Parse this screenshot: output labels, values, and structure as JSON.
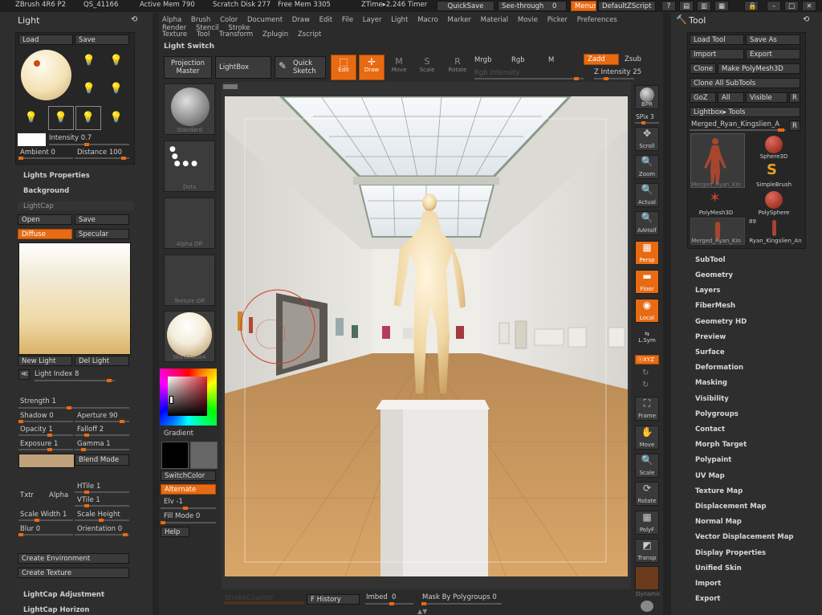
{
  "top_bar": {
    "app": "ZBrush 4R6 P2",
    "qs": "QS_41166",
    "active_mem": "Active Mem 790",
    "scratch": "Scratch Disk 277",
    "free_mem": "Free Mem 3305",
    "ztime": "ZTime▸2.246 Timer",
    "quicksave": "QuickSave",
    "see_through": "See-through",
    "see_through_value": "0",
    "menus": "Menus",
    "default_zscript": "DefaultZScript"
  },
  "main_menu": [
    "Alpha",
    "Brush",
    "Color",
    "Document",
    "Draw",
    "Edit",
    "File",
    "Layer",
    "Light",
    "Macro",
    "Marker",
    "Material",
    "Movie",
    "Picker",
    "Preferences",
    "Render",
    "Stencil",
    "Stroke"
  ],
  "main_menu2": [
    "Texture",
    "Tool",
    "Transform",
    "Zplugin",
    "Zscript"
  ],
  "light_switch": "Light Switch",
  "toolbar": {
    "projection_master": "Projection Master",
    "lightbox": "LightBox",
    "quick_sketch": "Quick Sketch",
    "edit": "Edit",
    "draw": "Draw",
    "move": "Move",
    "scale": "Scale",
    "rotate": "Rotate",
    "mrgb": "Mrgb",
    "rgb": "Rgb",
    "m": "M",
    "rgb_intensity": "Rgb Intensity",
    "zadd": "Zadd",
    "zsub": "Zsub",
    "z_intensity": "Z Intensity 25"
  },
  "light_panel": {
    "title": "Light",
    "load": "Load",
    "save": "Save",
    "intensity": "Intensity 0.7",
    "ambient": "Ambient 0",
    "distance": "Distance 100",
    "lights_properties": "Lights Properties",
    "background": "Background",
    "lightcap": "LightCap",
    "open": "Open",
    "save2": "Save",
    "diffuse": "Diffuse",
    "specular": "Specular",
    "new_light": "New Light",
    "del_light": "Del Light",
    "light_index": "Light Index 8",
    "strength": "Strength 1",
    "shadow": "Shadow 0",
    "aperture": "Aperture 90",
    "opacity": "Opacity 1",
    "falloff": "Falloff 2",
    "exposure": "Exposure 1",
    "gamma": "Gamma 1",
    "blend_mode": "Blend Mode",
    "txtr": "Txtr",
    "alpha": "Alpha",
    "htile": "HTile 1",
    "vtile": "VTile 1",
    "scale_width": "Scale Width 1",
    "scale_height": "Scale Height",
    "blur": "Blur 0",
    "orientation": "Orientation 0",
    "create_environment": "Create Environment",
    "create_texture": "Create Texture",
    "lightcap_adjustment": "LightCap Adjustment",
    "lightcap_horizon": "LightCap Horizon"
  },
  "left_tray": {
    "standard": "Standard",
    "dots": "Dots",
    "alpha_off": "Alpha Off",
    "texture_off": "Texture Off",
    "skin_shade": "SkinShade4",
    "gradient": "Gradient",
    "switch_color": "SwitchColor",
    "alternate": "Alternate",
    "elv": "Elv -1",
    "fill_mode": "Fill Mode 0",
    "help": "Help"
  },
  "right_tray": {
    "bpr": "BPR",
    "spix": "SPix 3",
    "scroll": "Scroll",
    "zoom": "Zoom",
    "actual": "Actual",
    "aahalf": "AAHalf",
    "persp": "Persp",
    "floor": "Floor",
    "local": "Local",
    "lsym": "L.Sym",
    "xyz": "ⓧXYZ",
    "frame": "Frame",
    "move": "Move",
    "scale": "Scale",
    "rotate": "Rotate",
    "polyf": "PolyF",
    "transp": "Transp",
    "dynamic": "Dynamic"
  },
  "bottom_bar": {
    "stroke_counter": "StrokeCounter",
    "history": "F History",
    "imbed": "Imbed",
    "imbed_value": "0",
    "mask_by_polygroups": "Mask By Polygroups 0"
  },
  "tool_panel": {
    "title": "Tool",
    "load_tool": "Load Tool",
    "save_as": "Save As",
    "import": "Import",
    "export": "Export",
    "clone": "Clone",
    "make_polymesh": "Make PolyMesh3D",
    "clone_all": "Clone All SubTools",
    "goz": "GoZ",
    "all": "All",
    "visible": "Visible",
    "r": "R",
    "lightbox_tools": "Lightbox▸ Tools",
    "current_tool": "Merged_Ryan_Kingslien_A",
    "r2": "R",
    "tools": [
      {
        "name": "Merged_Ryan_Kin"
      },
      {
        "name": "Sphere3D"
      },
      {
        "name": "SimpleBrush"
      },
      {
        "name": "PolyMesh3D"
      },
      {
        "name": "PolySphere"
      },
      {
        "name": "Merged_Ryan_Kin"
      },
      {
        "name": "Ryan_Kingslien_An"
      }
    ],
    "tool_count": "89",
    "menu": [
      "SubTool",
      "Geometry",
      "Layers",
      "FiberMesh",
      "Geometry HD",
      "Preview",
      "Surface",
      "Deformation",
      "Masking",
      "Visibility",
      "Polygroups",
      "Contact",
      "Morph Target",
      "Polypaint",
      "UV Map",
      "Texture Map",
      "Displacement Map",
      "Normal Map",
      "Vector Displacement Map",
      "Display Properties",
      "Unified Skin",
      "Import",
      "Export"
    ]
  }
}
